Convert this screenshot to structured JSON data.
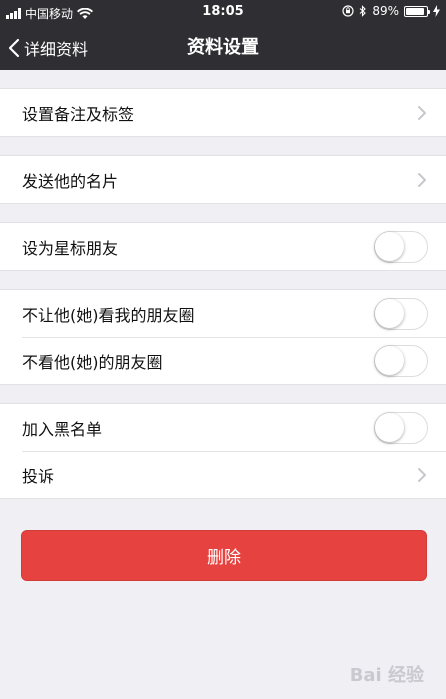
{
  "status_bar": {
    "carrier": "中国移动",
    "time": "18:05",
    "battery_percent": "89%",
    "battery_level": 0.89
  },
  "nav": {
    "back_label": "详细资料",
    "title": "资料设置"
  },
  "rows": {
    "set_remark": "设置备注及标签",
    "send_card": "发送他的名片",
    "star_friend": "设为星标朋友",
    "hide_my_moments": "不让他(她)看我的朋友圈",
    "hide_their_moments": "不看他(她)的朋友圈",
    "blacklist": "加入黑名单",
    "complain": "投诉"
  },
  "toggles": {
    "star_friend": false,
    "hide_my_moments": false,
    "hide_their_moments": false,
    "blacklist": false
  },
  "delete_label": "删除",
  "watermark": "Bai 经验",
  "colors": {
    "nav_bg": "#2e2e33",
    "page_bg": "#efeff4",
    "delete_bg": "#e64340"
  },
  "icons": [
    "signal-icon",
    "wifi-icon",
    "back-chevron-icon",
    "chevron-right-icon",
    "lock-rotation-icon",
    "bluetooth-icon",
    "battery-icon",
    "charging-icon"
  ]
}
